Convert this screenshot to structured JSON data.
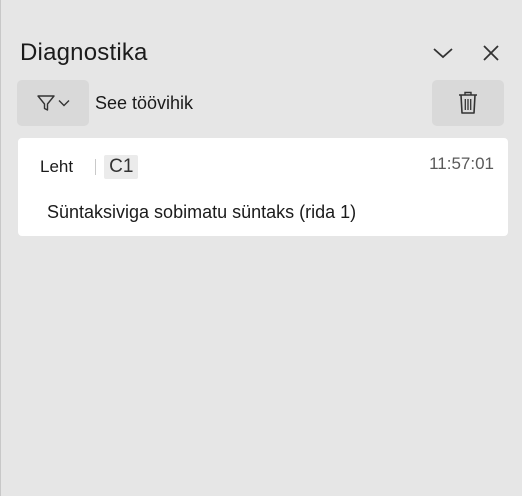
{
  "pane": {
    "title": "Diagnostika"
  },
  "toolbar": {
    "scope_label": "See töövihik"
  },
  "entries": [
    {
      "sheet_label": "Leht",
      "cell": "C1",
      "time": "11:57:01",
      "message": "Süntaksiviga sobimatu süntaks (rida 1)"
    }
  ],
  "icons": {
    "collapse": "chevron-down-icon",
    "close": "close-icon",
    "filter": "filter-icon",
    "delete": "trash-icon"
  }
}
